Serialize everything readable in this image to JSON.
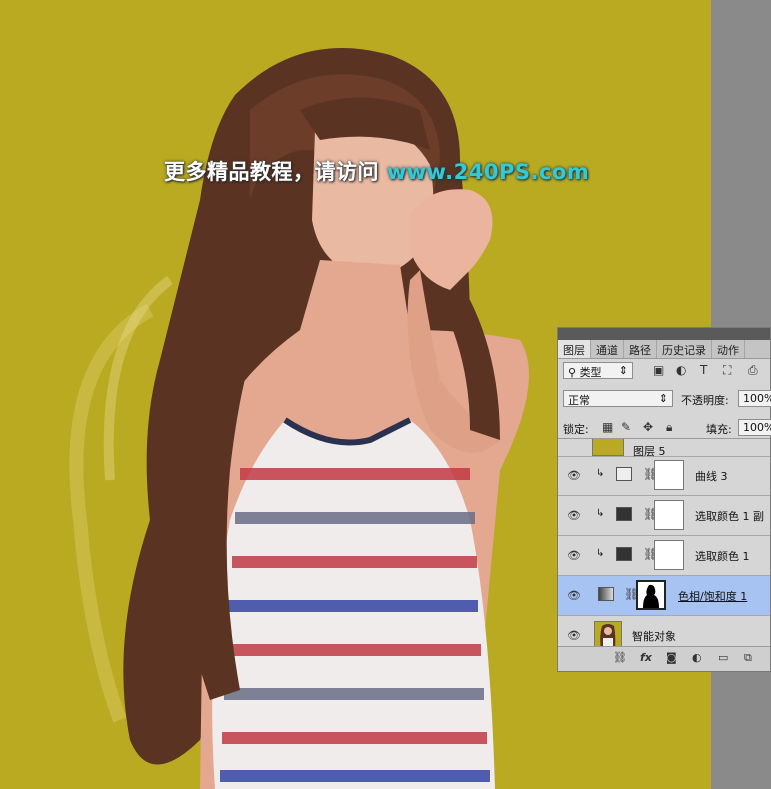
{
  "watermark": {
    "prefix": "更多精品教程，请访问 ",
    "url": "www.240PS.com"
  },
  "colors": {
    "canvas_bg": "#b9aa22",
    "selected_layer": "#a7c3f2",
    "watermark_url": "#35c9d3"
  },
  "layers_panel": {
    "tabs": [
      "图层",
      "通道",
      "路径",
      "历史记录",
      "动作"
    ],
    "active_tab": "图层",
    "filter_label": "类型",
    "blend_mode": "正常",
    "opacity_label": "不透明度:",
    "opacity_value": "100%",
    "lock_label": "锁定:",
    "fill_label": "填充:",
    "fill_value": "100%",
    "layers": [
      {
        "name": "图层 5",
        "type": "pixel",
        "visible": false,
        "clipped": false,
        "selected": false
      },
      {
        "name": "曲线 3",
        "type": "curves",
        "visible": true,
        "clipped": true,
        "selected": false
      },
      {
        "name": "选取颜色 1 副",
        "type": "selective-color",
        "visible": true,
        "clipped": true,
        "selected": false
      },
      {
        "name": "选取颜色 1",
        "type": "selective-color",
        "visible": true,
        "clipped": true,
        "selected": false
      },
      {
        "name": "色相/饱和度 1",
        "type": "hue-saturation",
        "visible": true,
        "clipped": false,
        "selected": true
      },
      {
        "name": "智能对象",
        "type": "smart-object",
        "visible": true,
        "clipped": false,
        "selected": false
      }
    ],
    "bottom_icons": [
      "link-icon",
      "fx-icon",
      "mask-icon",
      "adjustment-icon",
      "folder-icon",
      "new-layer-icon"
    ]
  }
}
